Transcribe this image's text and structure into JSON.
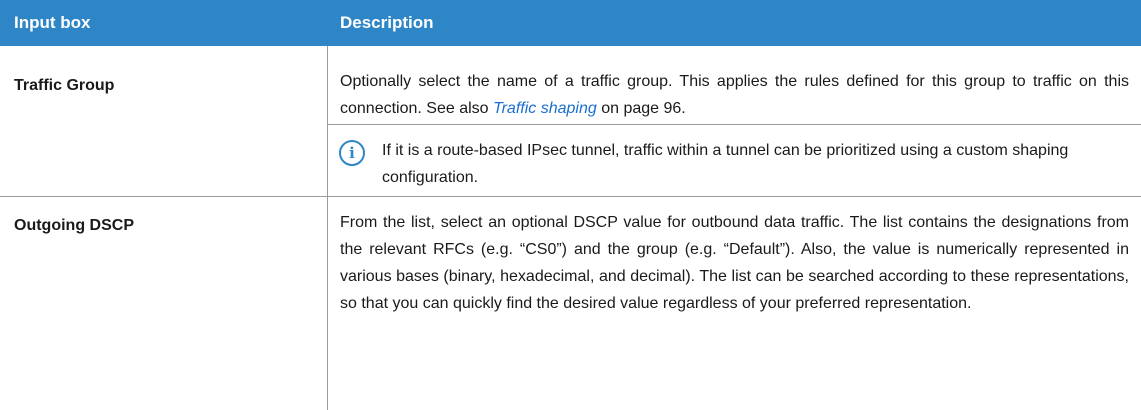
{
  "table": {
    "header": {
      "col1": "Input box",
      "col2": "Description"
    },
    "rows": [
      {
        "label": "Traffic Group",
        "desc_before": "Optionally select the name of a traffic group. This applies the rules defined for this group to traffic on this connection. See also ",
        "link": "Traffic shaping",
        "desc_after": " on page 96.",
        "note_icon": "info-icon",
        "note": "If it is a route-based IPsec tunnel, traffic within a tunnel can be prioritized using a custom shaping configuration."
      },
      {
        "label": "Outgoing DSCP",
        "desc": "From the list, select an optional DSCP value for outbound data traffic. The list contains the designations from the relevant RFCs (e.g. “CS0”) and the group (e.g. “Default”). Also, the value is numerically represented in various bases (binary, hexadecimal, and decimal). The list can be searched according to these representations, so that you can quickly find the desired value regardless of your preferred representation."
      }
    ]
  },
  "colors": {
    "header_bg": "#2f86c6",
    "header_text": "#ffffff",
    "link": "#1a6fd0",
    "icon": "#2f86c6"
  }
}
